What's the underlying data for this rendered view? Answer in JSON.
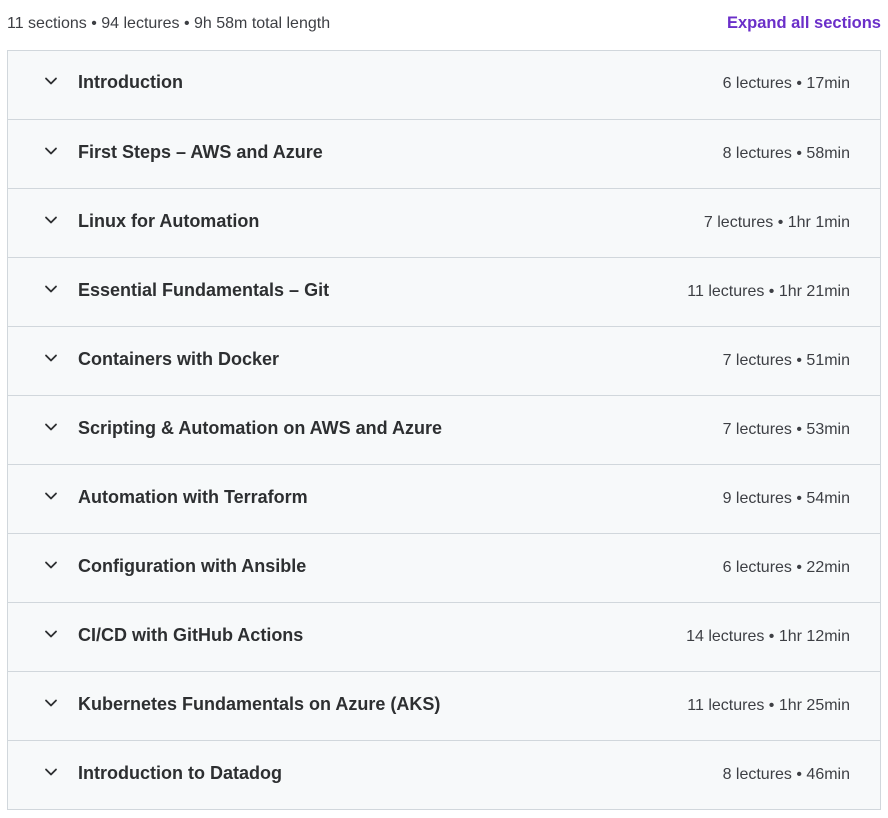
{
  "summary": "11 sections • 94 lectures • 9h 58m total length",
  "expand_all_label": "Expand all sections",
  "icon": "chevron-down-icon",
  "sections": [
    {
      "title": "Introduction",
      "meta": "6 lectures • 17min"
    },
    {
      "title": "First Steps – AWS and Azure",
      "meta": "8 lectures • 58min"
    },
    {
      "title": "Linux for Automation",
      "meta": "7 lectures • 1hr 1min"
    },
    {
      "title": "Essential Fundamentals – Git",
      "meta": "11 lectures • 1hr 21min"
    },
    {
      "title": "Containers with Docker",
      "meta": "7 lectures • 51min"
    },
    {
      "title": "Scripting & Automation on AWS and Azure",
      "meta": "7 lectures • 53min"
    },
    {
      "title": "Automation with Terraform",
      "meta": "9 lectures • 54min"
    },
    {
      "title": "Configuration with Ansible",
      "meta": "6 lectures • 22min"
    },
    {
      "title": "CI/CD with GitHub Actions",
      "meta": "14 lectures • 1hr 12min"
    },
    {
      "title": "Kubernetes Fundamentals on Azure (AKS)",
      "meta": "11 lectures • 1hr 25min"
    },
    {
      "title": "Introduction to Datadog",
      "meta": "8 lectures • 46min"
    }
  ]
}
